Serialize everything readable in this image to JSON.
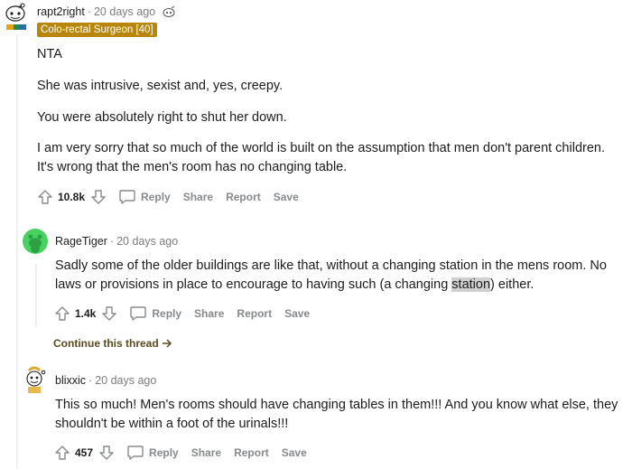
{
  "comments": [
    {
      "username": "rapt2right",
      "time": "20 days ago",
      "flair": "Colo-rectal Surgeon [40]",
      "paragraphs": [
        "NTA",
        "She was intrusive, sexist and, yes, creepy.",
        "You were absolutely right to shut her down.",
        "I am very sorry that so much of the world is built on the assumption that men don't parent children. It's wrong that the men's room has no changing table."
      ],
      "score": "10.8k",
      "actions": {
        "reply": "Reply",
        "share": "Share",
        "report": "Report",
        "save": "Save"
      }
    },
    {
      "username": "RageTiger",
      "time": "20 days ago",
      "body_before": "Sadly some of the older buildings are like that, without a changing station in the mens room. No laws or provisions in place to encourage to having such (a changing ",
      "body_highlight": "station",
      "body_after": ") either.",
      "score": "1.4k",
      "actions": {
        "reply": "Reply",
        "share": "Share",
        "report": "Report",
        "save": "Save"
      }
    },
    {
      "continue_label": "Continue this thread"
    },
    {
      "username": "blixxic",
      "time": "20 days ago",
      "body": "This so much! Men's rooms should have changing tables in them!!! And you know what else, they shouldn't be within a foot of the urinals!!!",
      "score": "457",
      "actions": {
        "reply": "Reply",
        "share": "Share",
        "report": "Report",
        "save": "Save"
      }
    }
  ],
  "separator": "·",
  "colors": {
    "flair_bg": "#b8860b",
    "continue_text": "#5b4a1f",
    "highlight": "#d0d0d0",
    "meta_gray": "#7c7c7c"
  },
  "icons": [
    "upvote-icon",
    "downvote-icon",
    "comment-bubble-icon",
    "arrow-right-icon",
    "snoo-avatar-icon",
    "flair-badge-icon"
  ]
}
